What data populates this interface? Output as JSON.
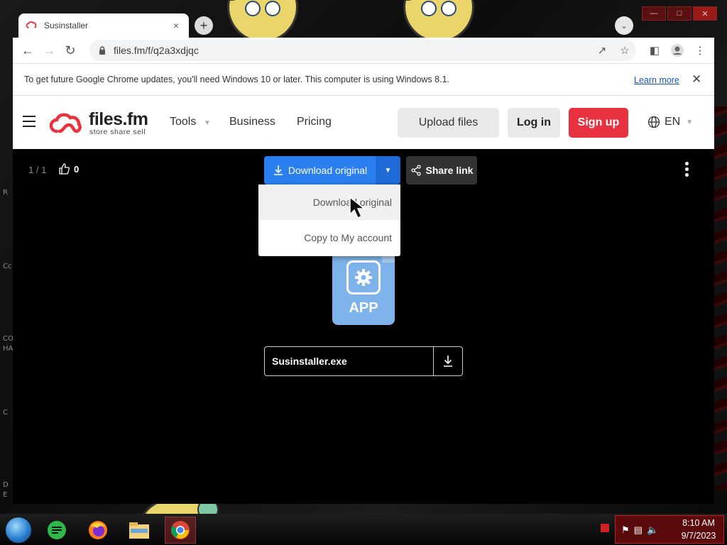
{
  "browser": {
    "tab_title": "Susinstaller",
    "tab_close": "×",
    "new_tab": "+",
    "url": "files.fm/f/q2a3xdjqc"
  },
  "infobar": {
    "message": "To get future Google Chrome updates, you'll need Windows 10 or later. This computer is using Windows 8.1.",
    "learn_more": "Learn more",
    "close": "✕"
  },
  "site": {
    "logo_name": "files.fm",
    "logo_tagline": "store  share  sell",
    "nav": {
      "tools": "Tools",
      "business": "Business",
      "pricing": "Pricing"
    },
    "upload_label": "Upload files",
    "login_label": "Log in",
    "signup_label": "Sign up",
    "lang": "EN",
    "brand_color": "#e8323f"
  },
  "viewer": {
    "counter": "1 / 1",
    "likes": "0",
    "download_label": "Download original",
    "share_label": "Share link",
    "dropdown": [
      {
        "label": "Download original"
      },
      {
        "label": "Copy to My account"
      }
    ],
    "app_label": "APP",
    "filename": "Susinstaller.exe",
    "accent": "#2b7ff0"
  },
  "taskbar": {
    "time": "8:10 AM",
    "date": "9/7/2023"
  },
  "desktop": {
    "edge_letters": [
      "R",
      "Cc",
      "CO",
      "HA",
      "C",
      "D",
      "E"
    ]
  }
}
